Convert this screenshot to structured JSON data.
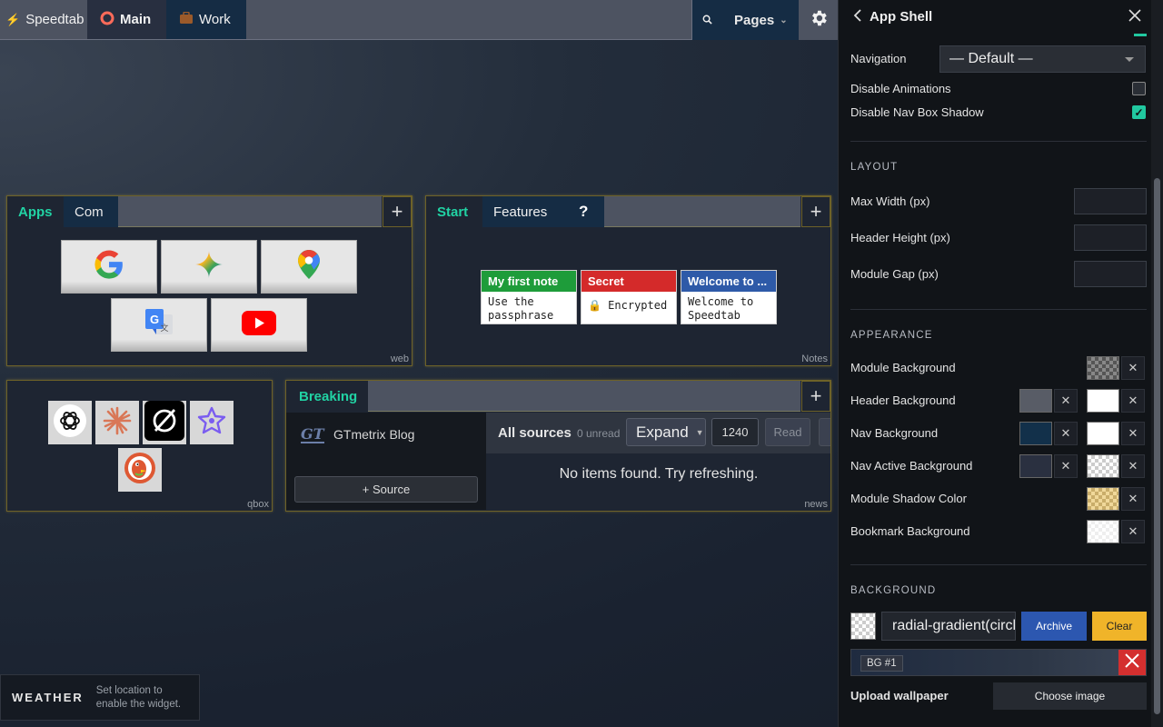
{
  "nav": {
    "brand": "Speedtab",
    "pages": [
      {
        "label": "Main",
        "icon": "ring-icon"
      },
      {
        "label": "Work",
        "icon": "briefcase-icon"
      }
    ],
    "pages_button": "Pages"
  },
  "modules": {
    "apps": {
      "tabs": [
        "Apps",
        "Com"
      ],
      "label": "web",
      "bookmarks": [
        "google-icon",
        "gemini-icon",
        "maps-icon",
        "translate-icon",
        "youtube-icon"
      ]
    },
    "notes": {
      "tabs": [
        "Start",
        "Features",
        "?"
      ],
      "label": "Notes",
      "items": [
        {
          "title": "My first note",
          "body": "Use the passphrase",
          "color": "#1e9c3a"
        },
        {
          "title": "Secret",
          "body": "🔒 Encrypted",
          "color": "#d42a2a"
        },
        {
          "title": "Welcome to ...",
          "body": "Welcome to Speedtab",
          "color": "#2e5aa8"
        }
      ]
    },
    "qbox": {
      "label": "qbox",
      "icons": [
        "chatgpt-icon",
        "claude-icon",
        "grok-icon",
        "perplexity-icon",
        "duckduckgo-icon"
      ]
    },
    "news": {
      "tab": "Breaking",
      "label": "news",
      "source_name": "GTmetrix Blog",
      "source_logo": "GT",
      "add_source": "+ Source",
      "all_sources": "All sources",
      "unread": "0 unread",
      "expand": "Expand",
      "count": "1240",
      "read": "Read",
      "empty": "No items found. Try refreshing."
    }
  },
  "weather": {
    "title": "WEATHER",
    "message": "Set location to enable the widget."
  },
  "panel": {
    "title": "App Shell",
    "navigation_label": "Navigation",
    "navigation_value": "— Default —",
    "disable_animations": "Disable Animations",
    "disable_animations_checked": false,
    "disable_shadow": "Disable Nav Box Shadow",
    "disable_shadow_checked": true,
    "layout": {
      "heading": "LAYOUT",
      "max_width": "Max Width (px)",
      "header_height": "Header Height (px)",
      "module_gap": "Module Gap (px)"
    },
    "appearance": {
      "heading": "APPEARANCE",
      "module_bg": "Module Background",
      "header_bg": "Header Background",
      "nav_bg": "Nav Background",
      "nav_active_bg": "Nav Active Background",
      "shadow_color": "Module Shadow Color",
      "bookmark_bg": "Bookmark Background"
    },
    "background": {
      "heading": "BACKGROUND",
      "value": "radial-gradient(circle",
      "archive": "Archive",
      "clear": "Clear",
      "bg_tag": "BG #1",
      "upload_label": "Upload wallpaper",
      "choose": "Choose image"
    },
    "colors": {
      "header": "#585c66",
      "nav": "#12304a",
      "nav_active": "#2a3040"
    }
  }
}
